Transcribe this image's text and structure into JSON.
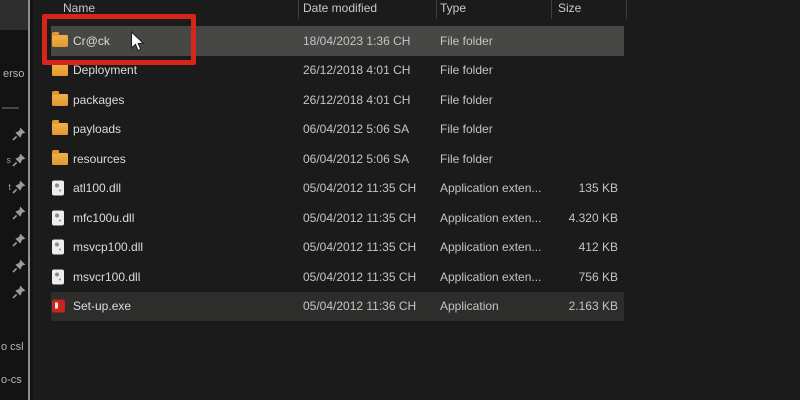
{
  "explorer": {
    "columns": {
      "name": "Name",
      "date": "Date modified",
      "type": "Type",
      "size": "Size"
    },
    "rows": [
      {
        "name": "Cr@ck",
        "icon": "folder",
        "date": "18/04/2023 1:36 CH",
        "type": "File folder",
        "size": "",
        "state": "selected"
      },
      {
        "name": "Deployment",
        "icon": "folder",
        "date": "26/12/2018 4:01 CH",
        "type": "File folder",
        "size": "",
        "state": "normal"
      },
      {
        "name": "packages",
        "icon": "folder",
        "date": "26/12/2018 4:01 CH",
        "type": "File folder",
        "size": "",
        "state": "normal"
      },
      {
        "name": "payloads",
        "icon": "folder",
        "date": "06/04/2012 5:06 SA",
        "type": "File folder",
        "size": "",
        "state": "normal"
      },
      {
        "name": "resources",
        "icon": "folder",
        "date": "06/04/2012 5:06 SA",
        "type": "File folder",
        "size": "",
        "state": "normal"
      },
      {
        "name": "atl100.dll",
        "icon": "dll",
        "date": "05/04/2012 11:35 CH",
        "type": "Application exten...",
        "size": "135 KB",
        "state": "normal"
      },
      {
        "name": "mfc100u.dll",
        "icon": "dll",
        "date": "05/04/2012 11:35 CH",
        "type": "Application exten...",
        "size": "4.320 KB",
        "state": "normal"
      },
      {
        "name": "msvcp100.dll",
        "icon": "dll",
        "date": "05/04/2012 11:35 CH",
        "type": "Application exten...",
        "size": "412 KB",
        "state": "normal"
      },
      {
        "name": "msvcr100.dll",
        "icon": "dll",
        "date": "05/04/2012 11:35 CH",
        "type": "Application exten...",
        "size": "756 KB",
        "state": "normal"
      },
      {
        "name": "Set-up.exe",
        "icon": "exe",
        "date": "05/04/2012 11:36 CH",
        "type": "Application",
        "size": "2.163 KB",
        "state": "highlight"
      }
    ]
  },
  "sidebar": {
    "fragment_top": "erso",
    "fragment_bottom_1": "o csl",
    "fragment_bottom_2": "o-cs",
    "pins": [
      {
        "prefix": ""
      },
      {
        "prefix": "s"
      },
      {
        "prefix": "t"
      },
      {
        "prefix": ""
      },
      {
        "prefix": ""
      },
      {
        "prefix": ""
      },
      {
        "prefix": ""
      }
    ]
  },
  "overlay": {
    "annotation_color": "#d6251b",
    "selected_row_color": "#474745",
    "setup_row_color": "#2d2d2c",
    "folder_icon_color": "#e9a23b",
    "exe_icon_color": "#c9241d"
  }
}
